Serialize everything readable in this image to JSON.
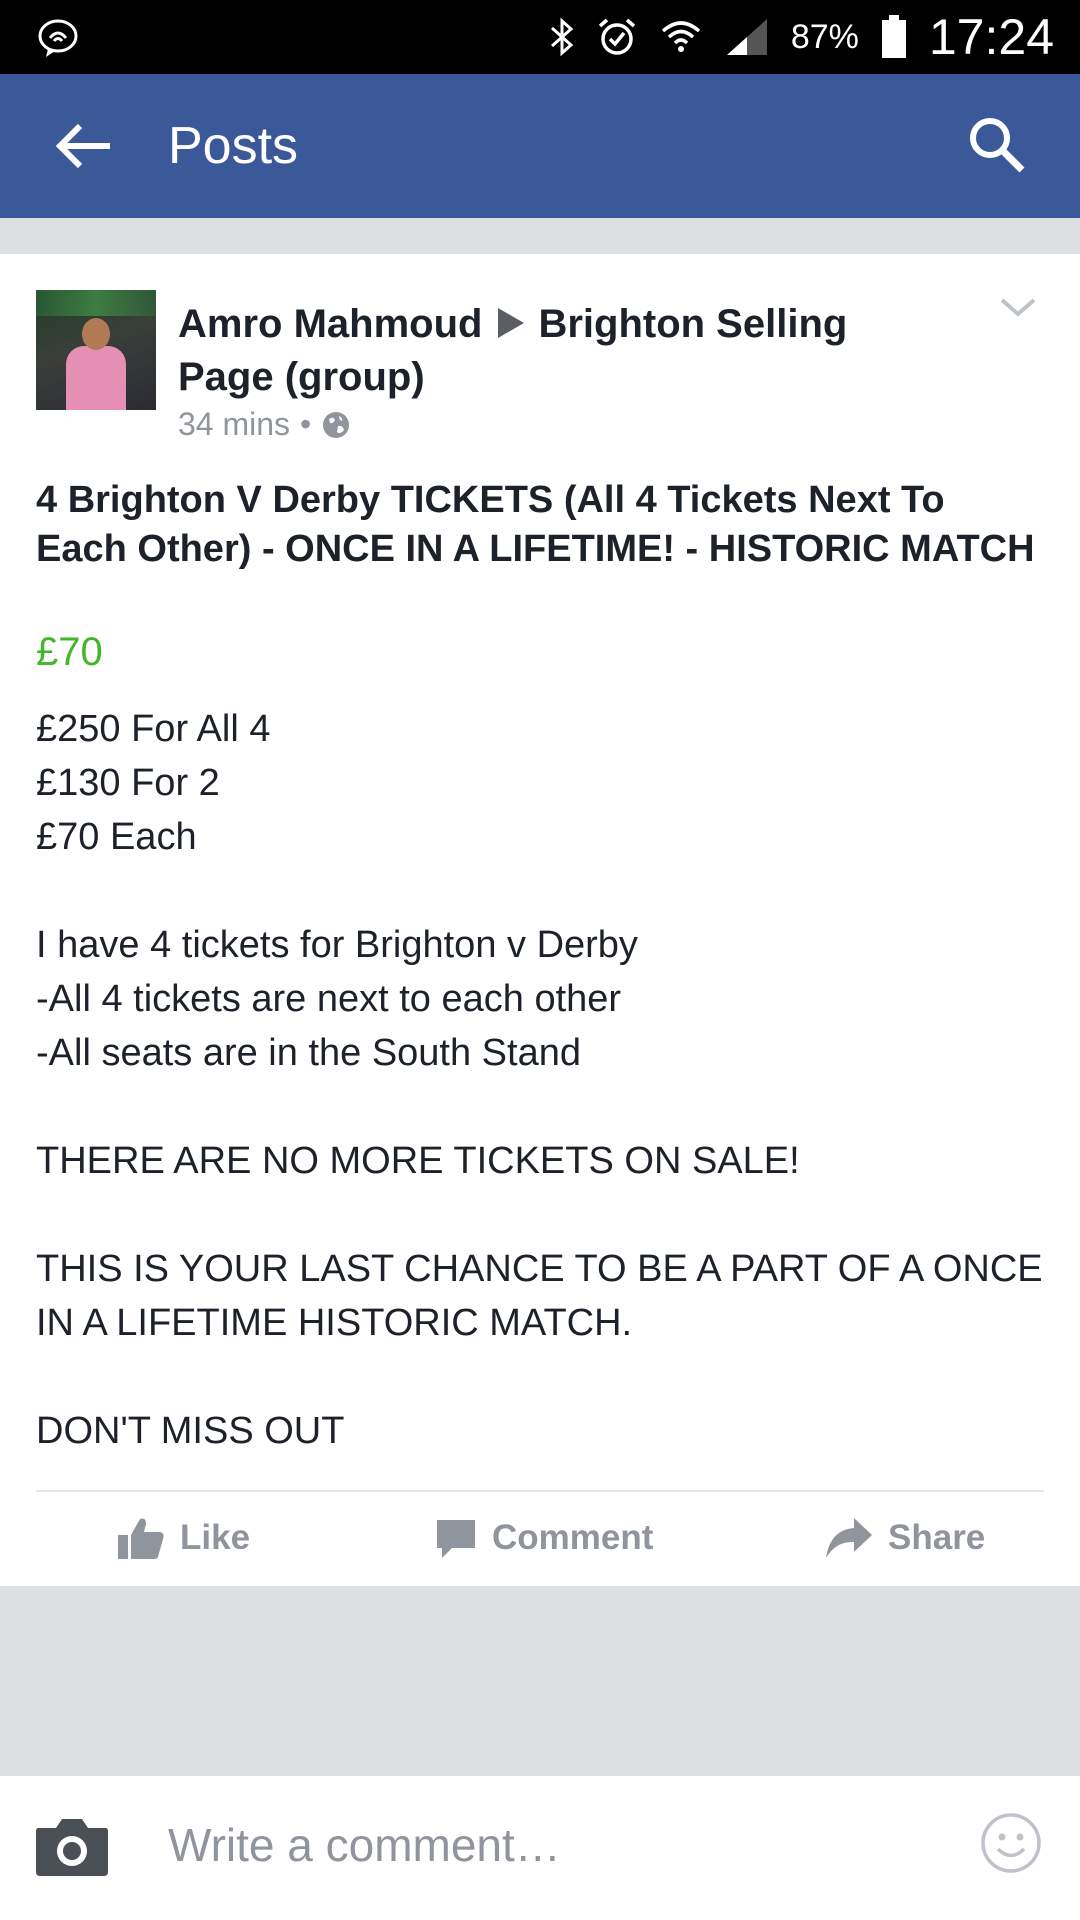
{
  "status_bar": {
    "battery": "87%",
    "time": "17:24"
  },
  "app_bar": {
    "title": "Posts"
  },
  "post": {
    "author": "Amro Mahmoud",
    "target": "Brighton Selling Page (group)",
    "time": "34 mins",
    "title": "4 Brighton V Derby TICKETS (All 4 Tickets Next To Each Other) - ONCE IN A LIFETIME! - HISTORIC MATCH",
    "price": "£70",
    "lines": [
      "£250 For All 4",
      "£130 For 2",
      "£70 Each",
      "",
      "I have 4 tickets for Brighton v Derby",
      "-All 4 tickets are next to each other",
      "-All seats are in the South Stand",
      "",
      "THERE ARE NO MORE TICKETS ON SALE!",
      "",
      "THIS IS YOUR LAST CHANCE TO BE A PART OF A ONCE IN A LIFETIME HISTORIC MATCH.",
      "",
      "DON'T MISS OUT"
    ]
  },
  "actions": {
    "like": "Like",
    "comment": "Comment",
    "share": "Share"
  },
  "composer": {
    "placeholder": "Write a comment…"
  },
  "colors": {
    "app_bar": "#3b5998",
    "price": "#42b72a",
    "muted": "#90949c"
  }
}
